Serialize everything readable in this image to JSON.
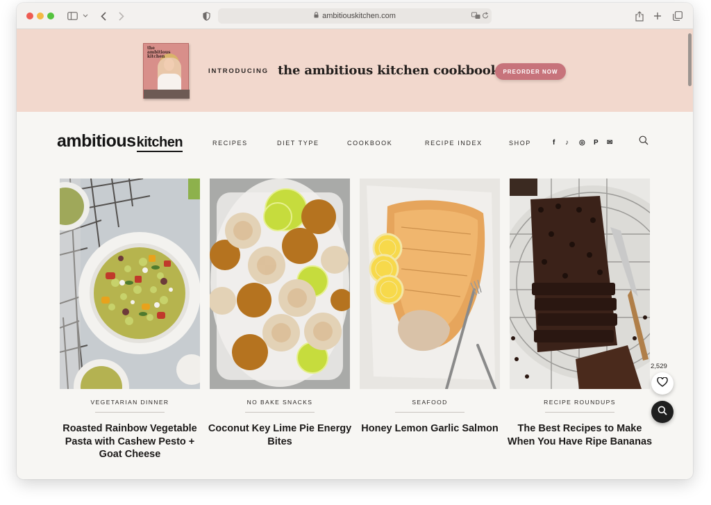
{
  "browser": {
    "url": "ambitiouskitchen.com",
    "icons": [
      "sidebar-icon",
      "chevron-down-icon",
      "back-icon",
      "forward-icon",
      "shield-icon",
      "lock-icon",
      "translate-icon",
      "reload-icon",
      "share-icon",
      "new-tab-icon",
      "tabs-icon"
    ]
  },
  "promo": {
    "book_title": "the ambitious kitchen",
    "introducing": "INTRODUCING",
    "headline": "the ambitious kitchen cookbook",
    "cta_label": "PREORDER NOW",
    "bg_color": "#f2d8cd",
    "cta_color": "#c7737b"
  },
  "site": {
    "logo_primary": "ambitious",
    "logo_secondary": "kitchen",
    "nav": [
      {
        "label": "RECIPES"
      },
      {
        "label": "DIET TYPE"
      },
      {
        "label": "COOKBOOK"
      },
      {
        "label": "RECIPE INDEX"
      },
      {
        "label": "SHOP"
      }
    ],
    "social": [
      {
        "icon": "facebook-icon",
        "glyph": "f"
      },
      {
        "icon": "tiktok-icon",
        "glyph": "♪"
      },
      {
        "icon": "instagram-icon",
        "glyph": "◎"
      },
      {
        "icon": "pinterest-icon",
        "glyph": "P"
      },
      {
        "icon": "email-icon",
        "glyph": "✉"
      }
    ],
    "search_icon": "search-icon"
  },
  "cards": [
    {
      "category": "VEGETARIAN DINNER",
      "title": "Roasted Rainbow Vegetable Pasta with Cashew Pesto + Goat Cheese",
      "image": "pasta-salad-bowl"
    },
    {
      "category": "NO BAKE SNACKS",
      "title": "Coconut Key Lime Pie Energy Bites",
      "image": "energy-bites-with-limes"
    },
    {
      "category": "SEAFOOD",
      "title": "Honey Lemon Garlic Salmon",
      "image": "salmon-with-lemon"
    },
    {
      "category": "RECIPE ROUNDUPS",
      "title": "The Best Recipes to Make When You Have Ripe Bananas",
      "image": "chocolate-banana-bread"
    }
  ],
  "floating": {
    "like_count": "2,529",
    "like_icon": "heart-icon",
    "search_icon": "search-icon"
  }
}
